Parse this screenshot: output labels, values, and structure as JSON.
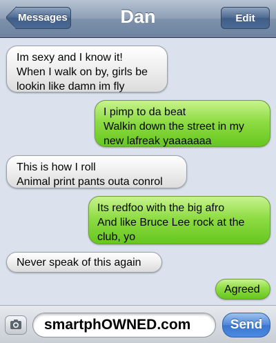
{
  "nav": {
    "back_label": "Messages",
    "title": "Dan",
    "edit_label": "Edit"
  },
  "messages": [
    {
      "direction": "incoming",
      "lines": [
        "Im sexy and I know it!",
        "When I walk on by, girls be",
        "lookin like damn im fly"
      ]
    },
    {
      "direction": "outgoing",
      "lines": [
        "I pimp to da beat",
        "Walkin down the street in my",
        "new lafreak yaaaaaaa"
      ]
    },
    {
      "direction": "incoming",
      "lines": [
        "This is how I roll",
        "Animal print pants outa conrol"
      ]
    },
    {
      "direction": "outgoing",
      "lines": [
        "Its redfoo with the big afro",
        "And like Bruce Lee rock at the",
        "club, yo"
      ]
    },
    {
      "direction": "incoming",
      "lines": [
        "Never speak of this again"
      ]
    },
    {
      "direction": "outgoing",
      "lines": [
        "Agreed"
      ]
    }
  ],
  "composer": {
    "camera_icon": "camera-icon",
    "input_value": "smartphOWNED.com",
    "send_label": "Send"
  }
}
